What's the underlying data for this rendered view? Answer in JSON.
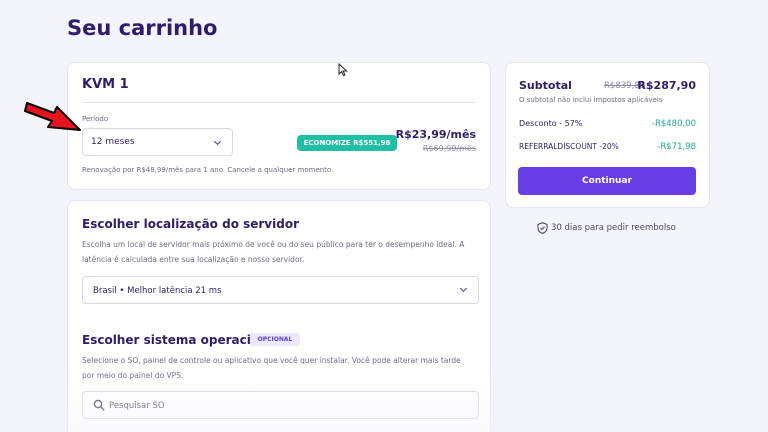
{
  "page": {
    "title": "Seu carrinho"
  },
  "plan": {
    "name": "KVM 1",
    "period_label": "Período",
    "period_value": "12 meses",
    "savings_badge": "ECONOMIZE R$551,98",
    "price": "R$23,99/mês",
    "old_price": "R$69,99/mês",
    "renewal_note": "Renovação por R$48,99/mês para 1 ano. Cancele a qualquer momento."
  },
  "location": {
    "title": "Escolher localização do servidor",
    "description": "Escolha um local de servidor mais próximo de você ou do seu público para ter o desempenho ideal. A latência é calculada entre sua localização e nosso servidor.",
    "selected": "Brasil • Melhor latência 21 ms"
  },
  "os": {
    "title": "Escolher sistema operacional",
    "badge": "OPCIONAL",
    "description": "Selecione o SO, painel de controle ou aplicativo que você quer instalar. Você pode alterar mais tarde por meio do painel do VPS.",
    "search_placeholder": "Pesquisar SO"
  },
  "summary": {
    "title": "Subtotal",
    "old_total": "R$839,88",
    "total": "R$287,90",
    "note": "O subtotal não inclui impostos aplicáveis",
    "discount_label": "Desconto - 57%",
    "discount_value": "-R$480,00",
    "referral_label": "REFERRALDISCOUNT -20%",
    "referral_value": "-R$71,98",
    "continue_label": "Continuar"
  },
  "refund": {
    "text": "30 dias para pedir reembolso"
  },
  "colors": {
    "accent": "#673de6",
    "success": "#1fbfa3",
    "heading": "#2f1c6a",
    "annotation_arrow": "#e8121f"
  }
}
